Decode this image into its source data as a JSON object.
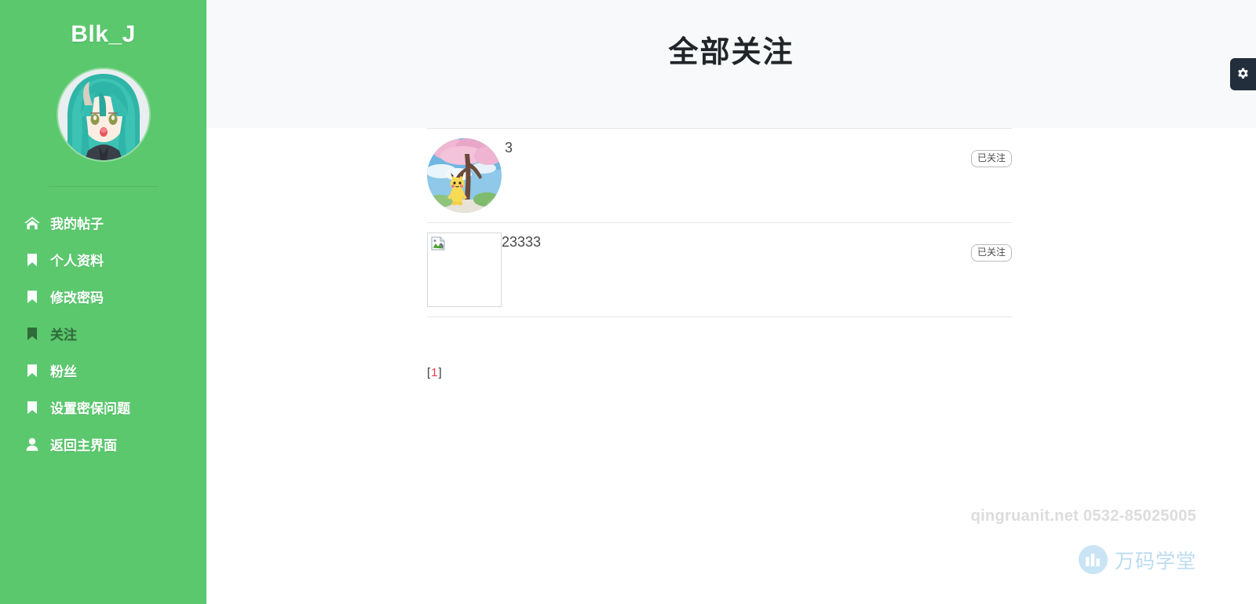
{
  "sidebar": {
    "brand": "Blk_J",
    "avatar_icon": "user-avatar-anime",
    "nav_items": [
      {
        "label": "我的帖子",
        "icon": "home-icon",
        "active": false
      },
      {
        "label": "个人资料",
        "icon": "bookmark-icon",
        "active": false
      },
      {
        "label": "修改密码",
        "icon": "bookmark-icon",
        "active": false
      },
      {
        "label": "关注",
        "icon": "bookmark-icon",
        "active": true
      },
      {
        "label": "粉丝",
        "icon": "bookmark-icon",
        "active": false
      },
      {
        "label": "设置密保问题",
        "icon": "bookmark-icon",
        "active": false
      },
      {
        "label": "返回主界面",
        "icon": "user-icon",
        "active": false
      }
    ]
  },
  "header": {
    "title": "全部关注",
    "gear_icon": "gear-icon"
  },
  "follow_list": [
    {
      "username": "3",
      "avatar_kind": "image",
      "avatar_icon": "pikachu-sakura-avatar",
      "action_label": "已关注"
    },
    {
      "username": "23333",
      "avatar_kind": "broken",
      "avatar_icon": "broken-image-icon",
      "action_label": "已关注"
    }
  ],
  "pagination": {
    "open_bracket": "[",
    "current_page": "1",
    "close_bracket": "]"
  },
  "watermark": {
    "contact": "qingruanit.net 0532-85025005",
    "logo_text": "万码学堂",
    "logo_icon": "wanma-logo-icon"
  },
  "colors": {
    "sidebar_green": "#5BC86E",
    "sidebar_active_text": "#2f6b39",
    "header_bg": "#F8F9FA",
    "title_color": "#212529",
    "gear_bg": "#222e3c",
    "page_accent_red": "#e8384f",
    "watermark_gray": "#dcdcdc",
    "logo_blue": "#bcdcf0"
  }
}
